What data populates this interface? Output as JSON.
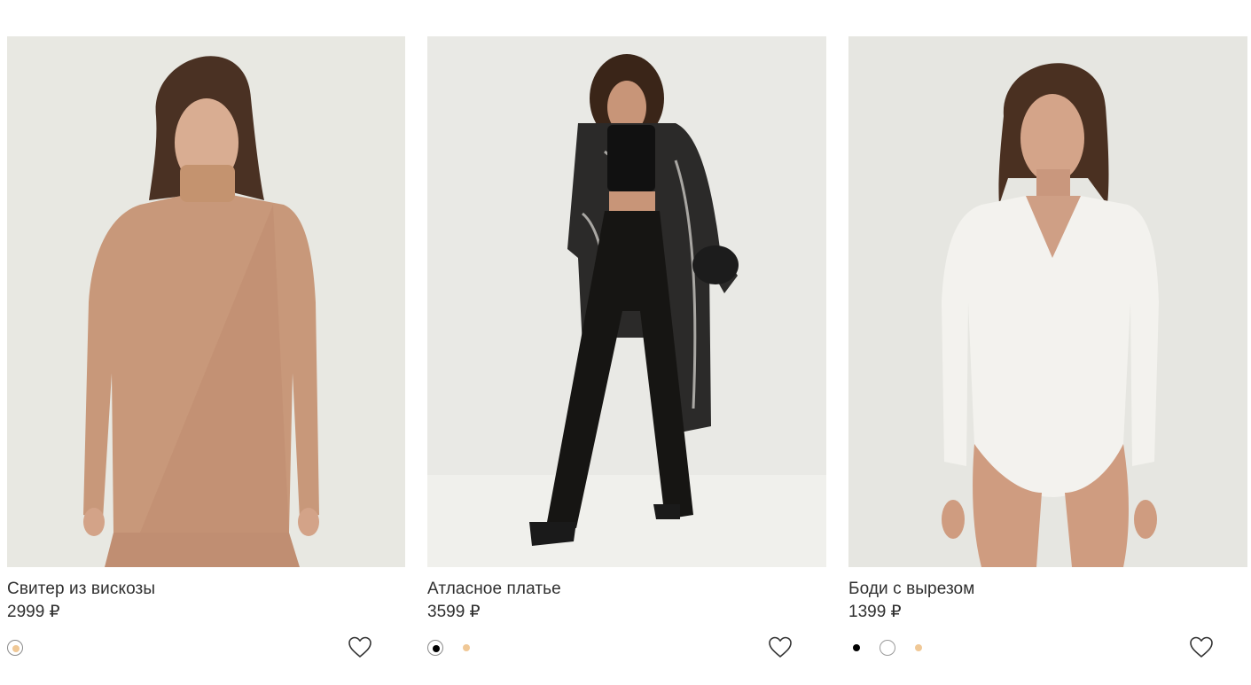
{
  "products": [
    {
      "title": "Свитер из вискозы",
      "price": "2999 ₽",
      "colors": [
        {
          "name": "camel",
          "hex": "#f0c896",
          "selected": true
        }
      ]
    },
    {
      "title": "Атласное платье",
      "price": "3599 ₽",
      "colors": [
        {
          "name": "black",
          "hex": "#000000",
          "selected": true
        },
        {
          "name": "beige",
          "hex": "#f0c896",
          "selected": false
        }
      ]
    },
    {
      "title": "Боди с вырезом",
      "price": "1399 ₽",
      "colors": [
        {
          "name": "black",
          "hex": "#000000",
          "selected": false
        },
        {
          "name": "white",
          "hex": "#ffffff",
          "selected": false
        },
        {
          "name": "beige",
          "hex": "#f0c896",
          "selected": false
        }
      ]
    }
  ],
  "icons": {
    "favorite": "heart-outline-icon"
  }
}
